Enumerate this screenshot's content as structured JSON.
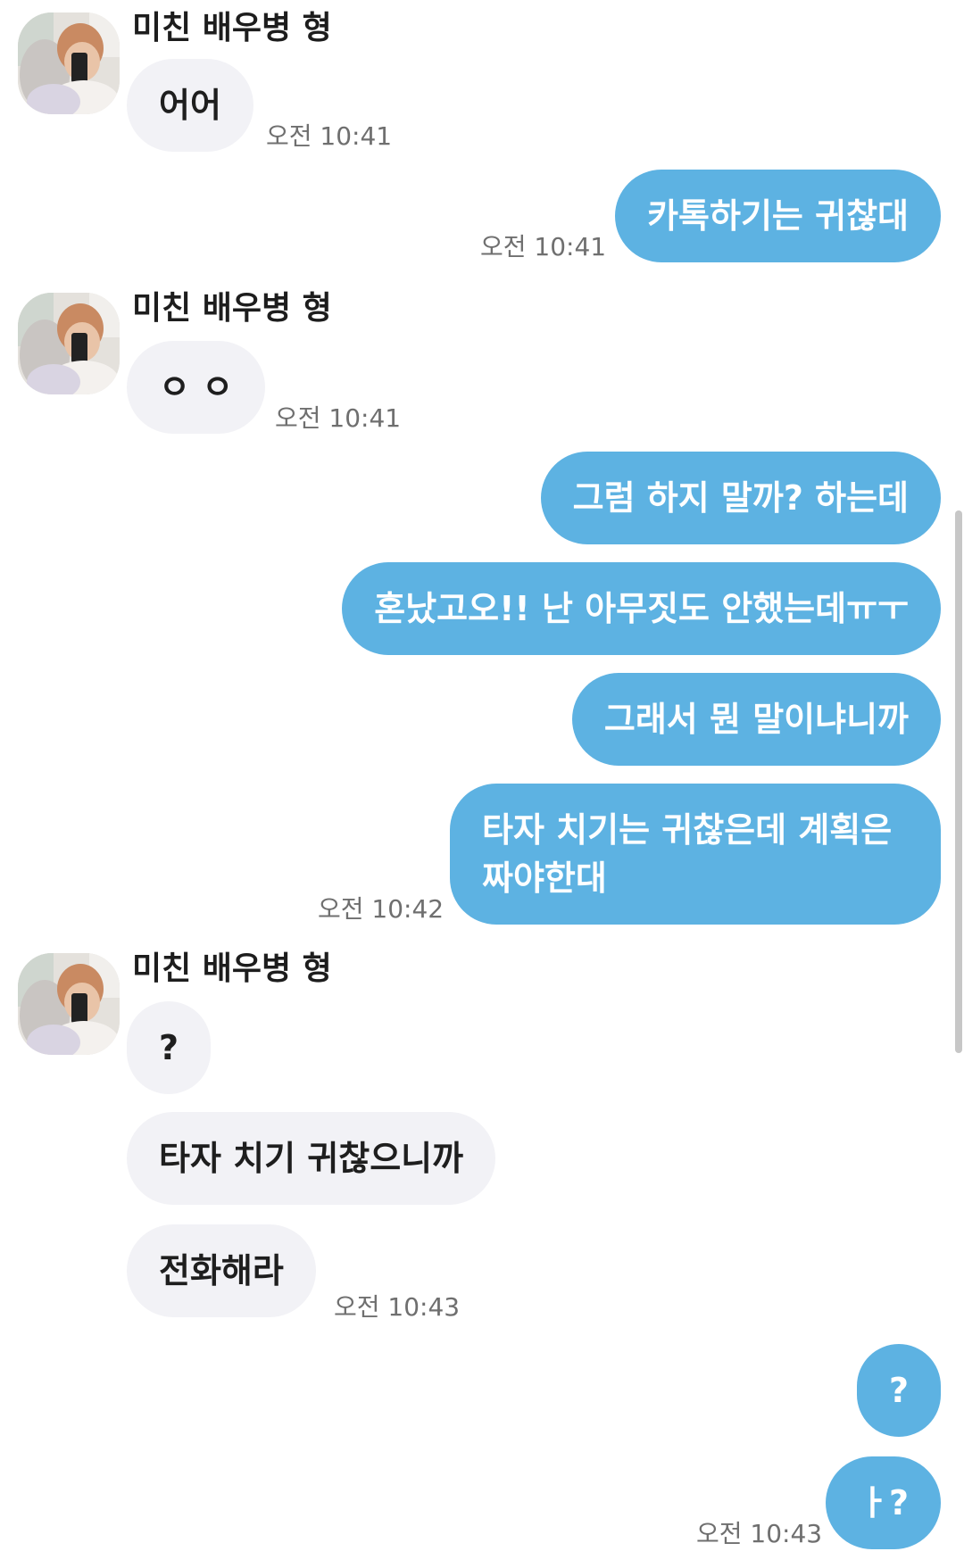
{
  "contact": {
    "name": "미친 배우병 형"
  },
  "messages": {
    "m1": {
      "text": "어어",
      "time": "오전 10:41"
    },
    "m2": {
      "text": "카톡하기는 귀찮대",
      "time": "오전 10:41"
    },
    "m3": {
      "text": "ㅇ ㅇ",
      "time": "오전 10:41"
    },
    "m4": {
      "text": "그럼 하지 말까? 하는데"
    },
    "m5": {
      "text": "혼났고오!! 난 아무짓도 안했는데ㅠㅜ"
    },
    "m6": {
      "text": "그래서 뭔 말이냐니까"
    },
    "m7": {
      "text": "타자 치기는 귀찮은데 계획은 짜야한대",
      "time": "오전 10:42"
    },
    "m8": {
      "text": "?"
    },
    "m9": {
      "text": "타자 치기 귀찮으니까"
    },
    "m10": {
      "text": "전화해라",
      "time": "오전 10:43"
    },
    "m11": {
      "text": "?"
    },
    "m12": {
      "text": "ㅏ?",
      "time": "오전 10:43"
    }
  },
  "colors": {
    "outgoing_bubble": "#5db2e2",
    "incoming_bubble": "#f2f2f6",
    "timestamp": "#6f6f6f"
  }
}
